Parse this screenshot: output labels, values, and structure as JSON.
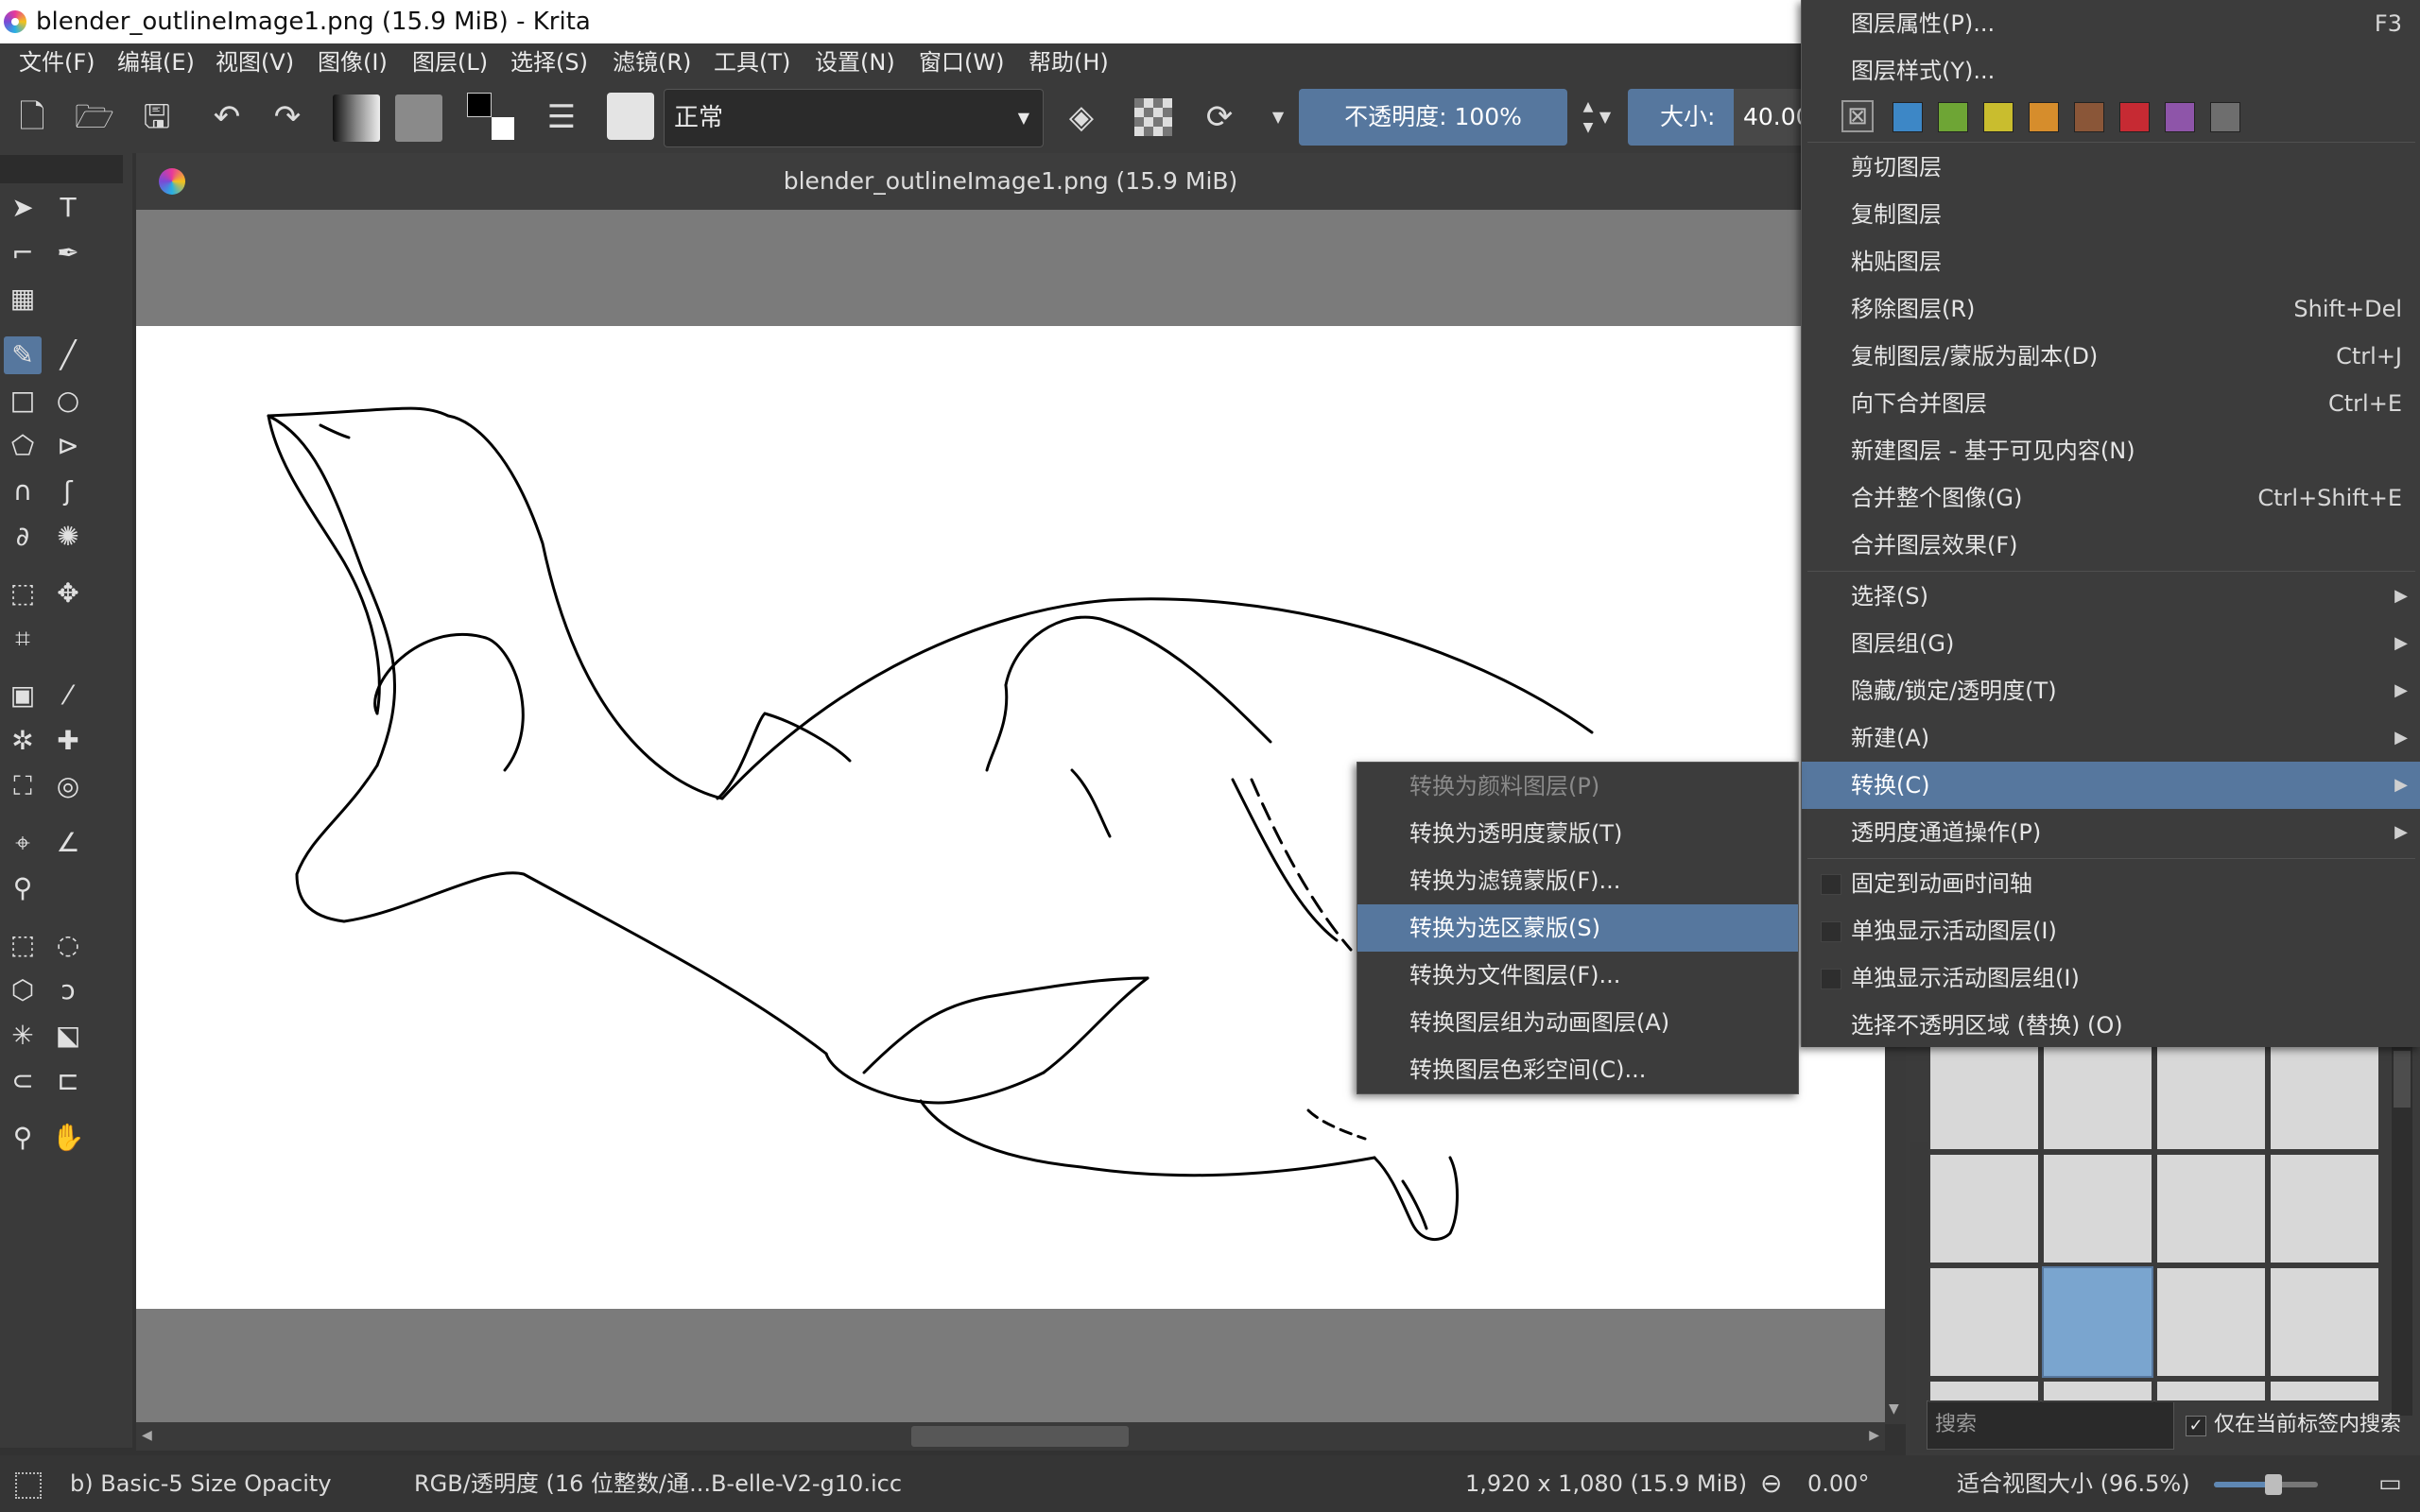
{
  "window": {
    "title": "blender_outlineImage1.png (15.9 MiB)  - Krita"
  },
  "menubar": {
    "items": [
      "文件(F)",
      "编辑(E)",
      "视图(V)",
      "图像(I)",
      "图层(L)",
      "选择(S)",
      "滤镜(R)",
      "工具(T)",
      "设置(N)",
      "窗口(W)",
      "帮助(H)"
    ]
  },
  "toolbar": {
    "blend_mode": "正常",
    "opacity_label": "不透明度: 100%",
    "size_label": "大小:",
    "size_value": "40.00"
  },
  "document": {
    "tab_title": "blender_outlineImage1.png (15.9 MiB)"
  },
  "status": {
    "brush_preset": "b) Basic-5 Size Opacity",
    "color_space": "RGB/透明度 (16 位整数/通...B-elle-V2-g10.icc",
    "image_size": "1,920 x 1,080 (15.9 MiB)",
    "rotation": "0.00°",
    "zoom": "适合视图大小 (96.5%)"
  },
  "brush_panel": {
    "search_placeholder": "搜索",
    "filter_label": "仅在当前标签内搜索"
  },
  "layer_menu": {
    "items": [
      {
        "label": "图层属性(P)...",
        "shortcut": "F3"
      },
      {
        "label": "图层样式(Y)...",
        "shortcut": ""
      },
      {
        "label": "剪切图层",
        "shortcut": ""
      },
      {
        "label": "复制图层",
        "shortcut": ""
      },
      {
        "label": "粘贴图层",
        "shortcut": ""
      },
      {
        "label": "移除图层(R)",
        "shortcut": "Shift+Del"
      },
      {
        "label": "复制图层/蒙版为副本(D)",
        "shortcut": "Ctrl+J"
      },
      {
        "label": "向下合并图层",
        "shortcut": "Ctrl+E"
      },
      {
        "label": "新建图层 - 基于可见内容(N)",
        "shortcut": ""
      },
      {
        "label": "合并整个图像(G)",
        "shortcut": "Ctrl+Shift+E"
      },
      {
        "label": "合并图层效果(F)",
        "shortcut": ""
      },
      {
        "label": "选择(S)",
        "shortcut": ""
      },
      {
        "label": "图层组(G)",
        "shortcut": ""
      },
      {
        "label": "隐藏/锁定/透明度(T)",
        "shortcut": ""
      },
      {
        "label": "新建(A)",
        "shortcut": ""
      },
      {
        "label": "转换(C)",
        "shortcut": ""
      },
      {
        "label": "透明度通道操作(P)",
        "shortcut": ""
      },
      {
        "label": "固定到动画时间轴",
        "shortcut": ""
      },
      {
        "label": "单独显示活动图层(I)",
        "shortcut": ""
      },
      {
        "label": "单独显示活动图层组(I)",
        "shortcut": ""
      },
      {
        "label": "选择不透明区域 (替换) (O)",
        "shortcut": ""
      }
    ],
    "color_labels": [
      "#3d87c6",
      "#6ea535",
      "#c9bd2e",
      "#d68d2c",
      "#8a5638",
      "#c62a33",
      "#8e55a9",
      "#6e6e6e"
    ]
  },
  "convert_submenu": {
    "items": [
      {
        "label": "转换为颜料图层(P)",
        "disabled": true
      },
      {
        "label": "转换为透明度蒙版(T)",
        "disabled": false
      },
      {
        "label": "转换为滤镜蒙版(F)...",
        "disabled": false
      },
      {
        "label": "转换为选区蒙版(S)",
        "disabled": false
      },
      {
        "label": "转换为文件图层(F)...",
        "disabled": false
      },
      {
        "label": "转换图层组为动画图层(A)",
        "disabled": false
      },
      {
        "label": "转换图层色彩空间(C)...",
        "disabled": false
      }
    ]
  }
}
